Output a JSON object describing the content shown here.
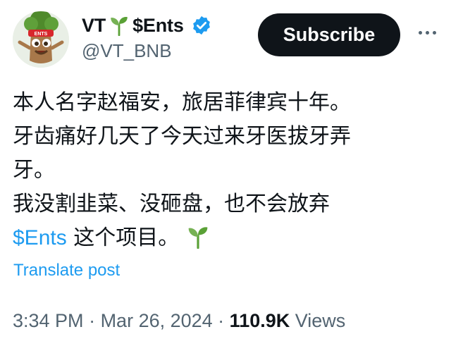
{
  "author": {
    "display_name_prefix": "VT",
    "display_name_suffix": "$Ents",
    "handle": "@VT_BNB",
    "avatar_badge_text": "ENTS"
  },
  "actions": {
    "subscribe_label": "Subscribe"
  },
  "tweet": {
    "lines": [
      "本人名字赵福安，旅居菲律宾十年。",
      "牙齿痛好几天了今天过来牙医拔牙弄",
      "牙。",
      "我没割韭菜、没砸盘，也不会放弃"
    ],
    "cashtag": "$Ents",
    "last_line_text": " 这个项目。"
  },
  "translate_label": "Translate post",
  "meta": {
    "time": "3:34 PM",
    "separator": " · ",
    "date": "Mar 26, 2024",
    "views_count": "110.9K",
    "views_label": " Views"
  },
  "colors": {
    "accent": "#1d9bf0",
    "text": "#0f1419",
    "muted": "#536471",
    "verified": "#1d9bf0",
    "sprout": "#5aa136"
  },
  "icons": {
    "sprout": "seedling-icon",
    "verified": "verified-badge-icon",
    "more": "more-horizontal-icon"
  }
}
